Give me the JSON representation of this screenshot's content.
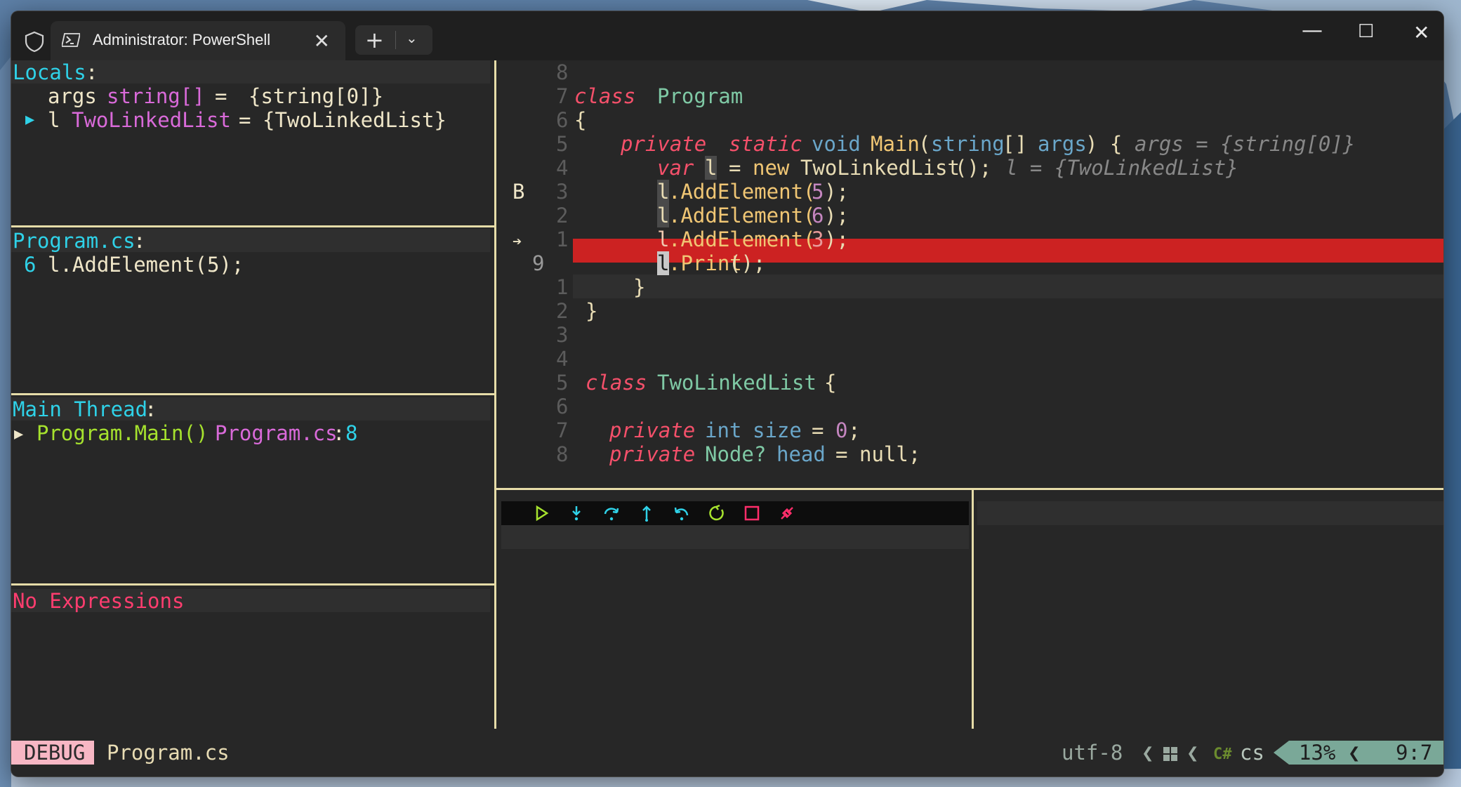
{
  "colors": {
    "accent_cyan": "#2fd2e8",
    "breakpoint_line": "#cc2222",
    "debug_badge": "#f7b7c4",
    "percent_badge": "#7aa898"
  },
  "window": {
    "tab_title": "Administrator: PowerShell",
    "tab_close": "✕",
    "new_tab": "+",
    "dropdown": "⌄",
    "minimize": "—",
    "maximize": "☐",
    "close": "✕"
  },
  "locals": {
    "header": "Locals",
    "colon": ":",
    "rows": [
      {
        "expander": "",
        "name": "args",
        "type": "string[]",
        "eq": "=",
        "value": "{string[0]}"
      },
      {
        "expander": "▶",
        "name": "l",
        "type": "TwoLinkedList",
        "eq": "=",
        "value": "{TwoLinkedList}"
      }
    ]
  },
  "breakpoints": {
    "file": "Program.cs",
    "colon": ":",
    "line": "6",
    "code": "l.AddElement(5);"
  },
  "threads": {
    "header": "Main Thread",
    "colon": ":",
    "expander": "▶",
    "frame": "Program.Main()",
    "file": "Program.cs",
    "colon2": ":",
    "line": "8"
  },
  "expressions": {
    "empty": "No Expressions"
  },
  "editor": {
    "gutter_numbers": [
      "8",
      "7",
      "6",
      "5",
      "4",
      "3",
      "2",
      "1",
      "9",
      "1",
      "2",
      "3",
      "4",
      "5",
      "6",
      "7",
      "8"
    ],
    "breakpoint_marker": "B",
    "current_marker": "➔",
    "lines": {
      "l1_kw": "class",
      "l1_name": "Program",
      "l2_brace": "{",
      "l3_private": "private",
      "l3_static": "static",
      "l3_void": "void",
      "l3_main": "Main",
      "l3_open": "(",
      "l3_string": "string",
      "l3_arr": "[]",
      "l3_args": "args",
      "l3_close": ") {",
      "l3_hint": "args = {string[0]}",
      "l4_var": "var",
      "l4_l": "l",
      "l4_eq": "=",
      "l4_new": "new",
      "l4_type": "TwoLinkedList",
      "l4_call": "();",
      "l4_hint": "l = {TwoLinkedList}",
      "l5_l": "l",
      "l5_method": ".AddElement(",
      "l5_arg": "5",
      "l5_end": ");",
      "l6_l": "l",
      "l6_method": ".AddElement(",
      "l6_arg": "6",
      "l6_end": ");",
      "l7_l": "l",
      "l7_method": ".AddElement(",
      "l7_arg": "3",
      "l7_end": ");",
      "l8_l": "l",
      "l8_method": ".Print",
      "l8_end": "();",
      "l9_brace": "}",
      "l10_brace": "}",
      "l11_kw": "class",
      "l11_name": "TwoLinkedList",
      "l11_brace": "{",
      "l12_private": "private",
      "l12_int": "int",
      "l12_name": "size",
      "l12_eq": "=",
      "l12_val": "0",
      "l12_end": ";",
      "l13_private": "private",
      "l13_type": "Node?",
      "l13_name": "head",
      "l13_eq": "=",
      "l13_val": "null;"
    }
  },
  "debug_toolbar": {
    "buttons": [
      "continue-icon",
      "step-into-icon",
      "step-over-icon",
      "step-out-icon",
      "step-back-icon",
      "restart-icon",
      "stop-icon",
      "disconnect-icon"
    ]
  },
  "statusline": {
    "mode": "DEBUG",
    "file": "Program.cs",
    "encoding": "utf-8",
    "sep": "❮",
    "lang_icon": "C#",
    "filetype": "cs",
    "percent": "13%",
    "position": "9:7"
  }
}
